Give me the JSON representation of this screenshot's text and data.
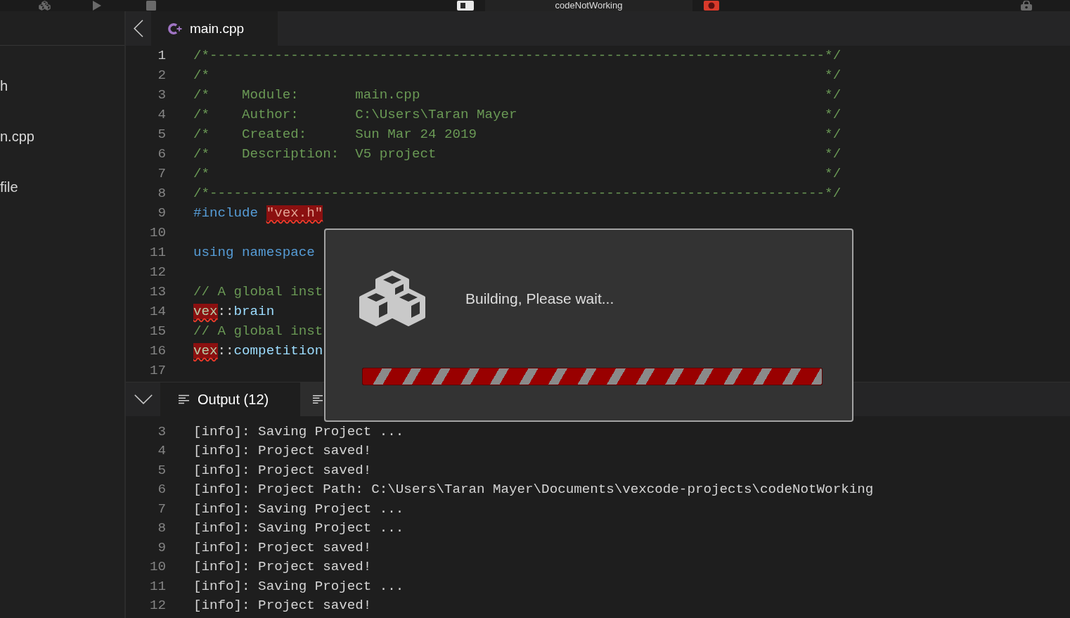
{
  "toolbar": {
    "project_name": "codeNotWorking"
  },
  "sidebar": {
    "items": [
      {
        "label": "h"
      },
      {
        "label": "n.cpp"
      },
      {
        "label": "file"
      }
    ]
  },
  "editor": {
    "tabs": [
      {
        "label": "main.cpp",
        "selected": true
      }
    ],
    "lines": [
      {
        "number": "1",
        "current": true,
        "tokens": [
          {
            "kind": "comment",
            "text": "/*----------------------------------------------------------------------------*/"
          }
        ]
      },
      {
        "number": "2",
        "current": false,
        "tokens": [
          {
            "kind": "comment",
            "text": "/*                                                                            */"
          }
        ]
      },
      {
        "number": "3",
        "current": false,
        "tokens": [
          {
            "kind": "comment",
            "text": "/*    Module:       main.cpp                                                  */"
          }
        ]
      },
      {
        "number": "4",
        "current": false,
        "tokens": [
          {
            "kind": "comment",
            "text": "/*    Author:       C:\\Users\\Taran Mayer                                      */"
          }
        ]
      },
      {
        "number": "5",
        "current": false,
        "tokens": [
          {
            "kind": "comment",
            "text": "/*    Created:      Sun Mar 24 2019                                           */"
          }
        ]
      },
      {
        "number": "6",
        "current": false,
        "tokens": [
          {
            "kind": "comment",
            "text": "/*    Description:  V5 project                                                */"
          }
        ]
      },
      {
        "number": "7",
        "current": false,
        "tokens": [
          {
            "kind": "comment",
            "text": "/*                                                                            */"
          }
        ]
      },
      {
        "number": "8",
        "current": false,
        "tokens": [
          {
            "kind": "comment",
            "text": "/*----------------------------------------------------------------------------*/"
          }
        ]
      },
      {
        "number": "9",
        "current": false,
        "tokens": [
          {
            "kind": "keyword",
            "text": "#include "
          },
          {
            "kind": "badstring",
            "text": "\"vex.h\""
          }
        ]
      },
      {
        "number": "10",
        "current": false
      },
      {
        "number": "11",
        "current": false,
        "tokens": [
          {
            "kind": "keyword",
            "text": "using namespace"
          }
        ]
      },
      {
        "number": "12",
        "current": false
      },
      {
        "number": "13",
        "current": false,
        "tokens": [
          {
            "kind": "comment",
            "text": "// A global inst"
          }
        ]
      },
      {
        "number": "14",
        "current": false,
        "tokens": [
          {
            "kind": "badname",
            "text": "vex"
          },
          {
            "kind": "punct",
            "text": "::"
          },
          {
            "kind": "member",
            "text": "brain"
          }
        ]
      },
      {
        "number": "15",
        "current": false,
        "tokens": [
          {
            "kind": "comment",
            "text": "// A global inst"
          }
        ]
      },
      {
        "number": "16",
        "current": false,
        "tokens": [
          {
            "kind": "badname",
            "text": "vex"
          },
          {
            "kind": "punct",
            "text": "::"
          },
          {
            "kind": "member",
            "text": "competition"
          }
        ]
      },
      {
        "number": "17",
        "current": false
      }
    ]
  },
  "output": {
    "tabs": [
      {
        "label": "Output (12)",
        "selected": true
      },
      {
        "selected": false
      }
    ],
    "lines": [
      {
        "number": "3",
        "text": "[info]: Saving Project ..."
      },
      {
        "number": "4",
        "text": "[info]: Project saved!"
      },
      {
        "number": "5",
        "text": "[info]: Project saved!"
      },
      {
        "number": "6",
        "text": "[info]: Project Path: C:\\Users\\Taran Mayer\\Documents\\vexcode-projects\\codeNotWorking"
      },
      {
        "number": "7",
        "text": "[info]: Saving Project ..."
      },
      {
        "number": "8",
        "text": "[info]: Saving Project ..."
      },
      {
        "number": "9",
        "text": "[info]: Project saved!"
      },
      {
        "number": "10",
        "text": "[info]: Project saved!"
      },
      {
        "number": "11",
        "text": "[info]: Saving Project ..."
      },
      {
        "number": "12",
        "text": "[info]: Project saved!"
      }
    ]
  },
  "dialog": {
    "message": "Building, Please wait...",
    "progress": {
      "level": 1
    }
  }
}
